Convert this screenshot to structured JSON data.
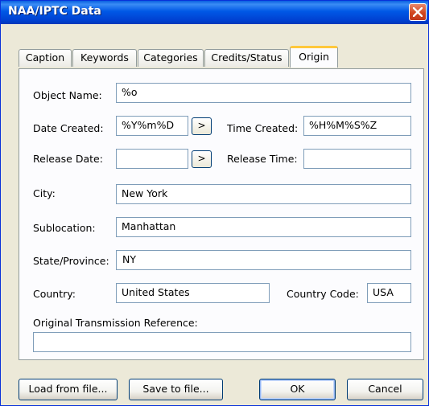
{
  "window": {
    "title": "NAA/IPTC Data"
  },
  "tabs": [
    "Caption",
    "Keywords",
    "Categories",
    "Credits/Status",
    "Origin"
  ],
  "active_tab": "Origin",
  "form": {
    "object_name_label": "Object Name:",
    "object_name_value": "%o",
    "date_created_label": "Date Created:",
    "date_created_value": "%Y%m%D",
    "time_created_label": "Time Created:",
    "time_created_value": "%H%M%S%Z",
    "release_date_label": "Release Date:",
    "release_date_value": "",
    "release_time_label": "Release Time:",
    "release_time_value": "",
    "arrow_label": ">",
    "city_label": "City:",
    "city_value": "New York",
    "sublocation_label": "Sublocation:",
    "sublocation_value": "Manhattan",
    "state_label": "State/Province:",
    "state_value": "NY",
    "country_label": "Country:",
    "country_value": "United States",
    "country_code_label": "Country Code:",
    "country_code_value": "USA",
    "otr_label": "Original Transmission Reference:",
    "otr_value": ""
  },
  "buttons": {
    "load": "Load from file...",
    "save": "Save to file...",
    "ok": "OK",
    "cancel": "Cancel"
  }
}
